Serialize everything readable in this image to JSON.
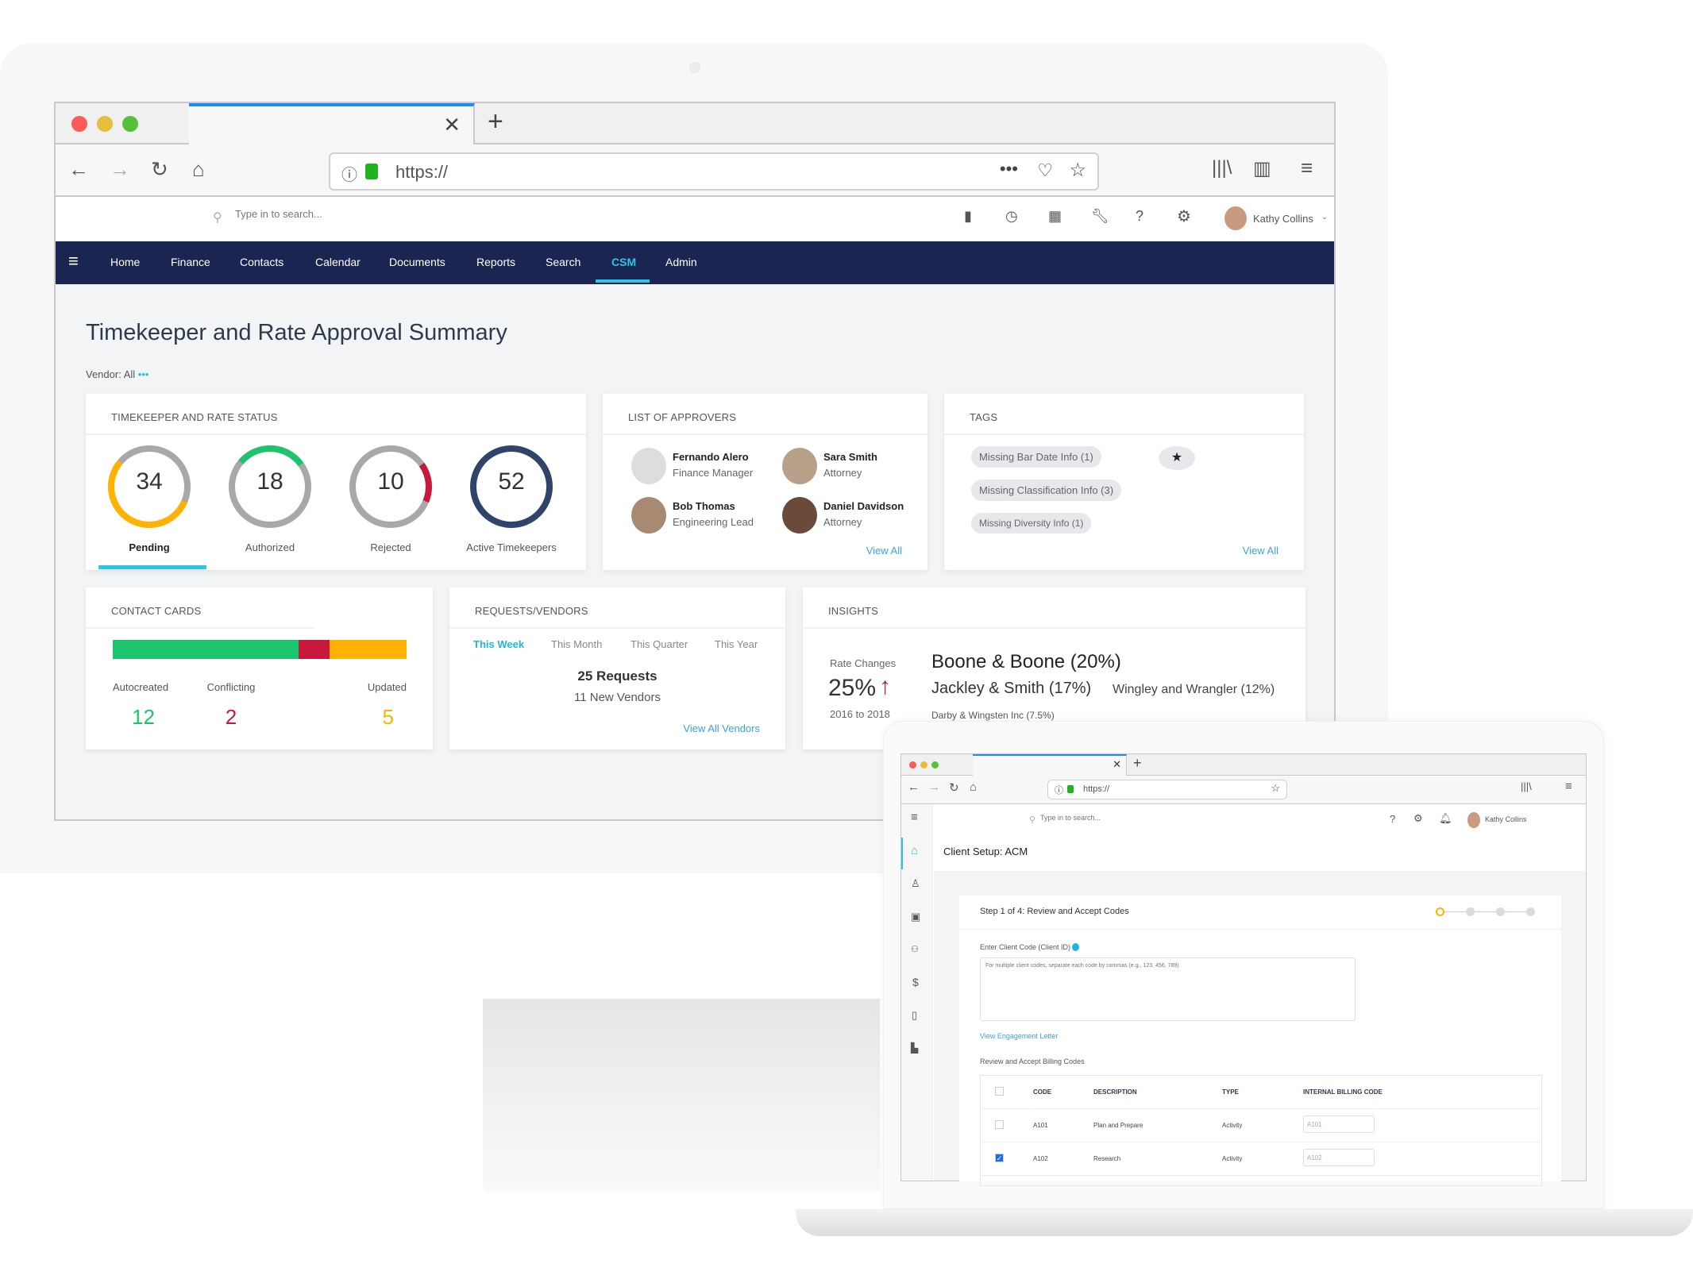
{
  "browser": {
    "url": "https://",
    "close_icon": "close-icon",
    "new_tab_icon": "plus-icon"
  },
  "app": {
    "search_placeholder": "Type in to search...",
    "user_name": "Kathy Collins",
    "nav": [
      "Home",
      "Finance",
      "Contacts",
      "Calendar",
      "Documents",
      "Reports",
      "Search",
      "CSM",
      "Admin"
    ],
    "active_nav": "CSM",
    "page_title": "Timekeeper and Rate Approval Summary",
    "vendor_filter": "Vendor: All",
    "vendor_more": "•••",
    "status": {
      "title": "Timekeeper and Rate Status",
      "items": [
        {
          "value": "34",
          "label": "Pending",
          "color": "#ffb300"
        },
        {
          "value": "18",
          "label": "Authorized",
          "color": "#1cc46e"
        },
        {
          "value": "10",
          "label": "Rejected",
          "color": "#c8183c"
        },
        {
          "value": "52",
          "label": "Active Timekeepers",
          "color": "#2f4468"
        }
      ]
    },
    "approvers": {
      "title": "List of Approvers",
      "people": [
        {
          "name": "Fernando Alero",
          "role": "Finance Manager"
        },
        {
          "name": "Sara Smith",
          "role": "Attorney"
        },
        {
          "name": "Bob Thomas",
          "role": "Engineering Lead"
        },
        {
          "name": "Daniel Davidson",
          "role": "Attorney"
        }
      ],
      "view_all": "View All"
    },
    "tags": {
      "title": "Tags",
      "items": [
        "Missing Bar Date Info (1)",
        "Missing Classification Info (3)",
        "Missing Diversity Info (1)"
      ],
      "view_all": "View All"
    },
    "contact_cards": {
      "title": "Contact Cards",
      "items": [
        {
          "label": "Autocreated",
          "value": "12",
          "color": "#1cc46e"
        },
        {
          "label": "Conflicting",
          "value": "2",
          "color": "#c8183c"
        },
        {
          "label": "Updated",
          "value": "5",
          "color": "#ffb300"
        }
      ]
    },
    "requests": {
      "title": "Requests/Vendors",
      "tabs": [
        "This Week",
        "This Month",
        "This Quarter",
        "This Year"
      ],
      "active_tab": "This Week",
      "requests": "25 Requests",
      "vendors": "11 New Vendors",
      "view_all": "View All Vendors"
    },
    "insights": {
      "title": "Insights",
      "rate_label": "Rate Changes",
      "rate_value": "25%",
      "rate_period": "2016 to 2018",
      "firms": [
        "Boone & Boone (20%)",
        "Jackley & Smith (17%)",
        "Wingley and Wrangler (12%)",
        "Darby & Wingsten Inc (7.5%)"
      ]
    }
  },
  "laptop": {
    "url": "https://",
    "search_placeholder": "Type in to search...",
    "user_name": "Kathy Collins",
    "page_title": "Client Setup: ACM",
    "step_title": "Step 1 of 4: Review and Accept Codes",
    "steps_total": 4,
    "current_step": 1,
    "client_code_label": "Enter Client Code (Client ID)",
    "client_code_placeholder": "For multiple client codes, separate each code by commas (e.g., 123, 456, 789)",
    "engagement_link": "View Engagement Letter",
    "billing_title": "Review and Accept Billing Codes",
    "columns": [
      "CODE",
      "DESCRIPTION",
      "TYPE",
      "INTERNAL BILLING CODE"
    ],
    "rows": [
      {
        "code": "A101",
        "description": "Plan and Prepare",
        "type": "Activity",
        "internal": "A101",
        "checked": false
      },
      {
        "code": "A102",
        "description": "Research",
        "type": "Activity",
        "internal": "A102",
        "checked": true
      }
    ]
  }
}
